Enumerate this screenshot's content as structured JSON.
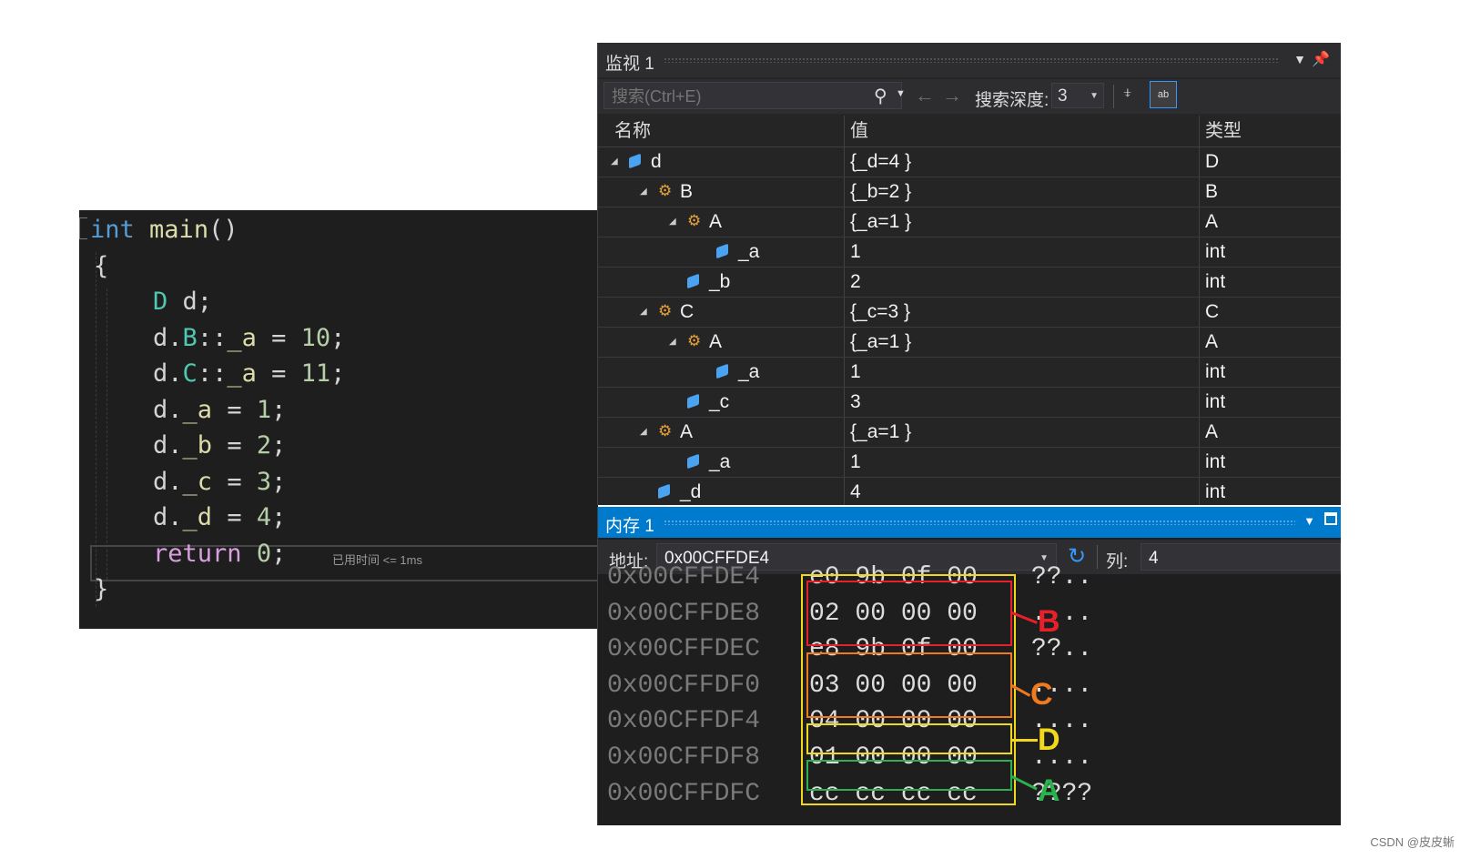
{
  "editor": {
    "lines": [
      [
        {
          "t": "int",
          "c": "kw"
        },
        {
          "t": " ",
          "c": "pl"
        },
        {
          "t": "main",
          "c": "fn"
        },
        {
          "t": "()",
          "c": "pl"
        }
      ],
      [
        {
          "t": "{",
          "c": "pl"
        }
      ],
      [
        {
          "t": "    ",
          "c": "pl"
        },
        {
          "t": "D",
          "c": "ty"
        },
        {
          "t": " d;",
          "c": "pl"
        }
      ],
      [
        {
          "t": "    d.",
          "c": "pl"
        },
        {
          "t": "B",
          "c": "ty"
        },
        {
          "t": "::",
          "c": "pl"
        },
        {
          "t": "_a",
          "c": "fd"
        },
        {
          "t": " = ",
          "c": "pl"
        },
        {
          "t": "10",
          "c": "nm"
        },
        {
          "t": ";",
          "c": "pl"
        }
      ],
      [
        {
          "t": "    d.",
          "c": "pl"
        },
        {
          "t": "C",
          "c": "ty"
        },
        {
          "t": "::",
          "c": "pl"
        },
        {
          "t": "_a",
          "c": "fd"
        },
        {
          "t": " = ",
          "c": "pl"
        },
        {
          "t": "11",
          "c": "nm"
        },
        {
          "t": ";",
          "c": "pl"
        }
      ],
      [
        {
          "t": "    d.",
          "c": "pl"
        },
        {
          "t": "_a",
          "c": "fd"
        },
        {
          "t": " = ",
          "c": "pl"
        },
        {
          "t": "1",
          "c": "nm"
        },
        {
          "t": ";",
          "c": "pl"
        }
      ],
      [
        {
          "t": "    d.",
          "c": "pl"
        },
        {
          "t": "_b",
          "c": "fd"
        },
        {
          "t": " = ",
          "c": "pl"
        },
        {
          "t": "2",
          "c": "nm"
        },
        {
          "t": ";",
          "c": "pl"
        }
      ],
      [
        {
          "t": "    d.",
          "c": "pl"
        },
        {
          "t": "_c",
          "c": "fd"
        },
        {
          "t": " = ",
          "c": "pl"
        },
        {
          "t": "3",
          "c": "nm"
        },
        {
          "t": ";",
          "c": "pl"
        }
      ],
      [
        {
          "t": "    d.",
          "c": "pl"
        },
        {
          "t": "_d",
          "c": "fd"
        },
        {
          "t": " = ",
          "c": "pl"
        },
        {
          "t": "4",
          "c": "nm"
        },
        {
          "t": ";",
          "c": "pl"
        }
      ],
      [
        {
          "t": "    ",
          "c": "pl"
        },
        {
          "t": "return",
          "c": "rt"
        },
        {
          "t": " ",
          "c": "pl"
        },
        {
          "t": "0",
          "c": "nm"
        },
        {
          "t": ";",
          "c": "pl"
        }
      ],
      [
        {
          "t": "}",
          "c": "pl"
        }
      ]
    ],
    "elapsed_hint": "已用时间 <= 1ms"
  },
  "watch": {
    "title": "监视 1",
    "search_placeholder": "搜索(Ctrl+E)",
    "depth_label": "搜索深度:",
    "depth_value": "3",
    "hex_icon_text": "ab",
    "columns": {
      "name": "名称",
      "value": "值",
      "type": "类型"
    },
    "rows": [
      {
        "level": 0,
        "expanded": true,
        "icon": "field",
        "name": "d",
        "value": "{_d=4 }",
        "type": "D"
      },
      {
        "level": 1,
        "expanded": true,
        "icon": "base",
        "name": "B",
        "value": "{_b=2 }",
        "type": "B"
      },
      {
        "level": 2,
        "expanded": true,
        "icon": "base",
        "name": "A",
        "value": "{_a=1 }",
        "type": "A"
      },
      {
        "level": 3,
        "expanded": null,
        "icon": "field",
        "name": "_a",
        "value": "1",
        "type": "int"
      },
      {
        "level": 2,
        "expanded": null,
        "icon": "field",
        "name": "_b",
        "value": "2",
        "type": "int"
      },
      {
        "level": 1,
        "expanded": true,
        "icon": "base",
        "name": "C",
        "value": "{_c=3 }",
        "type": "C"
      },
      {
        "level": 2,
        "expanded": true,
        "icon": "base",
        "name": "A",
        "value": "{_a=1 }",
        "type": "A"
      },
      {
        "level": 3,
        "expanded": null,
        "icon": "field",
        "name": "_a",
        "value": "1",
        "type": "int"
      },
      {
        "level": 2,
        "expanded": null,
        "icon": "field",
        "name": "_c",
        "value": "3",
        "type": "int"
      },
      {
        "level": 1,
        "expanded": true,
        "icon": "base",
        "name": "A",
        "value": "{_a=1 }",
        "type": "A"
      },
      {
        "level": 2,
        "expanded": null,
        "icon": "field",
        "name": "_a",
        "value": "1",
        "type": "int"
      },
      {
        "level": 1,
        "expanded": null,
        "icon": "field",
        "name": "_d",
        "value": "4",
        "type": "int"
      }
    ]
  },
  "memory": {
    "title": "内存 1",
    "address_label": "地址:",
    "address_value": "0x00CFFDE4",
    "columns_label": "列:",
    "columns_value": "4",
    "rows": [
      {
        "addr": "0x00CFFDE4",
        "bytes": "e0 9b 0f 00",
        "chars": "??.."
      },
      {
        "addr": "0x00CFFDE8",
        "bytes": "02 00 00 00",
        "chars": "...."
      },
      {
        "addr": "0x00CFFDEC",
        "bytes": "e8 9b 0f 00",
        "chars": "??.."
      },
      {
        "addr": "0x00CFFDF0",
        "bytes": "03 00 00 00",
        "chars": "...."
      },
      {
        "addr": "0x00CFFDF4",
        "bytes": "04 00 00 00",
        "chars": "...."
      },
      {
        "addr": "0x00CFFDF8",
        "bytes": "01 00 00 00",
        "chars": "...."
      },
      {
        "addr": "0x00CFFDFC",
        "bytes": "cc cc cc cc",
        "chars": "????"
      }
    ]
  },
  "annotations": [
    {
      "label": "B",
      "color": "#e8202a"
    },
    {
      "label": "C",
      "color": "#f07a1e"
    },
    {
      "label": "D",
      "color": "#f2d81c"
    },
    {
      "label": "A",
      "color": "#2bb24c"
    }
  ],
  "annotation_outer_color": "#f2d81c",
  "watermark": "CSDN @皮皮蜥"
}
